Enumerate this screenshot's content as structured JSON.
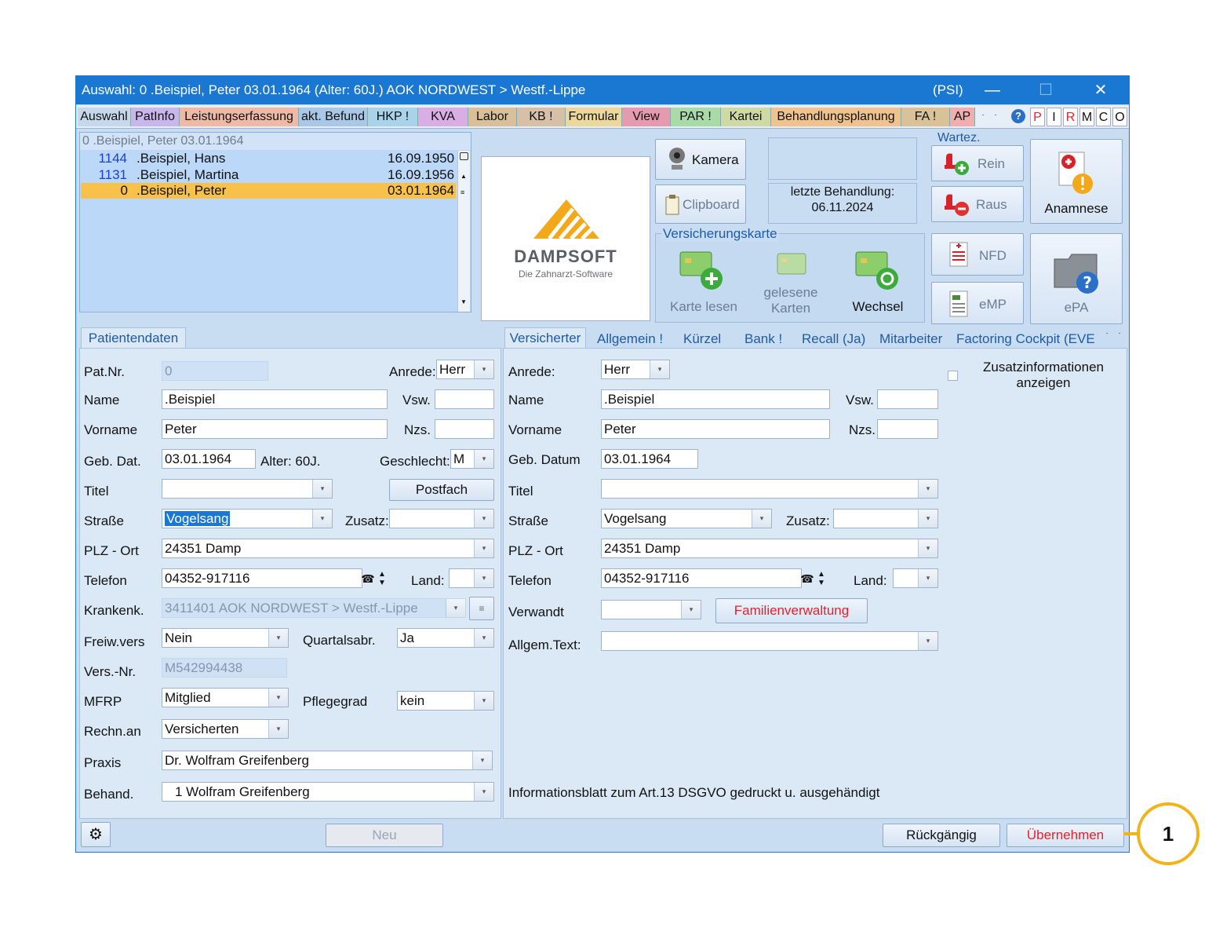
{
  "window": {
    "title": "Auswahl: 0  .Beispiel, Peter  03.01.1964 (Alter: 60J.)  AOK NORDWEST > Westf.-Lippe",
    "badge": "(PSI)",
    "minimize": "—",
    "maximize": "☐",
    "close": "✕"
  },
  "menu_tabs": [
    {
      "label": "Auswahl",
      "color": "#c8d8ec"
    },
    {
      "label": "PatInfo",
      "color": "#c9b6ea"
    },
    {
      "label": "Leistungserfassung",
      "color": "#f0b9a6"
    },
    {
      "label": "akt. Befund",
      "color": "#a9c7e6"
    },
    {
      "label": "HKP !",
      "color": "#a9d3e9"
    },
    {
      "label": "KVA",
      "color": "#d9aee5"
    },
    {
      "label": "Labor",
      "color": "#d9c098"
    },
    {
      "label": "KB !",
      "color": "#d8c0a8"
    },
    {
      "label": "Formular",
      "color": "#eed79a"
    },
    {
      "label": "View",
      "color": "#e59aaf"
    },
    {
      "label": "PAR !",
      "color": "#a9dba9"
    },
    {
      "label": "Kartei",
      "color": "#cfd9a3"
    },
    {
      "label": "Behandlungsplanung",
      "color": "#f0c28e"
    },
    {
      "label": "FA !",
      "color": "#d9c298"
    },
    {
      "label": "AP",
      "color": "#f2aeae"
    }
  ],
  "menu_letters": [
    "P",
    "I",
    "R",
    "M",
    "C",
    "O"
  ],
  "help_icon": "?",
  "patient_list": {
    "header": "0 .Beispiel, Peter  03.01.1964",
    "rows": [
      {
        "nr": "1144",
        "name": ".Beispiel, Hans",
        "date": "16.09.1950"
      },
      {
        "nr": "1131",
        "name": ".Beispiel, Martina",
        "date": "16.09.1956"
      },
      {
        "nr": "0",
        "name": ".Beispiel, Peter",
        "date": "03.01.1964"
      }
    ]
  },
  "logo": {
    "brand": "DAMPSOFT",
    "tagline": "Die Zahnarzt-Software"
  },
  "tools": {
    "kamera": "Kamera",
    "clipboard": "Clipboard"
  },
  "letzte": {
    "label": "letzte Behandlung:",
    "date": "06.11.2024"
  },
  "wartez": {
    "title": "Wartez.",
    "rein": "Rein",
    "raus": "Raus"
  },
  "anamnese": "Anamnese",
  "versicherungskarte": {
    "title": "Versicherungskarte",
    "lesen": "Karte lesen",
    "gelesene_1": "gelesene",
    "gelesene_2": "Karten",
    "wechsel": "Wechsel"
  },
  "nfd": "NFD",
  "emp": "eMP",
  "epa": "ePA",
  "left_tab": "Patientendaten",
  "left": {
    "patnr_l": "Pat.Nr.",
    "patnr": "0",
    "anrede_l": "Anrede:",
    "anrede": "Herr",
    "name_l": "Name",
    "name": ".Beispiel",
    "vsw_l": "Vsw.",
    "vorname_l": "Vorname",
    "vorname": "Peter",
    "nzs_l": "Nzs.",
    "gebdat_l": "Geb. Dat.",
    "gebdat": "03.01.1964",
    "alter": "Alter: 60J.",
    "geschlecht_l": "Geschlecht:",
    "geschlecht": "M",
    "titel_l": "Titel",
    "postfach": "Postfach",
    "strasse_l": "Straße",
    "strasse": "Vogelsang",
    "zusatz_l": "Zusatz:",
    "plz_l": "PLZ - Ort",
    "plz": "24351 Damp",
    "telefon_l": "Telefon",
    "telefon": "04352-917116",
    "land_l": "Land:",
    "krankenk_l": "Krankenk.",
    "krankenk": "3411401 AOK NORDWEST > Westf.-Lippe",
    "freiw_l": "Freiw.vers",
    "freiw": "Nein",
    "quartal_l": "Quartalsabr.",
    "quartal": "Ja",
    "versnr_l": "Vers.-Nr.",
    "versnr": "M542994438",
    "mfrp_l": "MFRP",
    "mfrp": "Mitglied",
    "pflege_l": "Pflegegrad",
    "pflege": "kein",
    "rechn_l": "Rechn.an",
    "rechn": "Versicherten",
    "praxis_l": "Praxis",
    "praxis": "Dr. Wolfram Greifenberg",
    "behand_l": "Behand.",
    "behand": "1 Wolfram Greifenberg"
  },
  "right_tabs": [
    "Versicherter",
    "Allgemein !",
    "Kürzel",
    "Bank !",
    "Recall (Ja)",
    "Mitarbeiter",
    "Factoring Cockpit (EVE"
  ],
  "right": {
    "anrede_l": "Anrede:",
    "anrede": "Herr",
    "zusatzinfo": "Zusatzinformationen anzeigen",
    "name_l": "Name",
    "name": ".Beispiel",
    "vsw_l": "Vsw.",
    "vorname_l": "Vorname",
    "vorname": "Peter",
    "nzs_l": "Nzs.",
    "gebdat_l": "Geb. Datum",
    "gebdat": "03.01.1964",
    "titel_l": "Titel",
    "strasse_l": "Straße",
    "strasse": "Vogelsang",
    "zusatz_l": "Zusatz:",
    "plz_l": "PLZ - Ort",
    "plz": "24351 Damp",
    "telefon_l": "Telefon",
    "telefon": "04352-917116",
    "land_l": "Land:",
    "verwandt_l": "Verwandt",
    "familien": "Familienverwaltung",
    "allgem_l": "Allgem.Text:",
    "info": "Informationsblatt zum Art.13 DSGVO gedruckt u. ausgehändigt"
  },
  "footer": {
    "neu": "Neu",
    "rueck": "Rückgängig",
    "ueber": "Übernehmen"
  },
  "callout": "1",
  "colors": {
    "accent": "#1a78d2",
    "selected_row": "#f8c14a",
    "red_text": "#e8202a",
    "callout": "#f0b41a"
  }
}
